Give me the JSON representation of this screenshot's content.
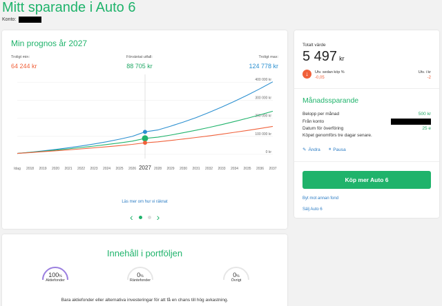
{
  "page": {
    "title": "Mitt sparande i Auto 6",
    "konto_label": "Konto:"
  },
  "prognos": {
    "title": "Min prognos år 2027",
    "min_label": "Troligt min:",
    "min_value": "64 244 kr",
    "expected_label": "Förväntat utfall:",
    "expected_value": "88 705 kr",
    "max_label": "Troligt max:",
    "max_value": "124 778 kr",
    "read_more": "Läs mer om hur vi räknat"
  },
  "chart_data": {
    "type": "line",
    "x": [
      "Idag",
      "2018",
      "2019",
      "2020",
      "2021",
      "2022",
      "2023",
      "2024",
      "2025",
      "2026",
      "2027",
      "2028",
      "2029",
      "2030",
      "2031",
      "2032",
      "2033",
      "2034",
      "2035",
      "2036",
      "2037"
    ],
    "highlight_x": "2027",
    "y_tick_labels": [
      "400 000 kr",
      "300 000 kr",
      "200 000 kr",
      "100 000 kr",
      "0 kr"
    ],
    "y_ticks": [
      400000,
      300000,
      200000,
      100000,
      0
    ],
    "ylim": [
      0,
      420000
    ],
    "series": [
      {
        "name": "Troligt max",
        "color": "#2a8fd0",
        "values": [
          5497,
          12000,
          19500,
          27500,
          36500,
          46500,
          57500,
          70000,
          84000,
          99500,
          124778,
          135000,
          156000,
          179000,
          204000,
          232000,
          262000,
          294000,
          328000,
          364000,
          402000
        ]
      },
      {
        "name": "Förväntat utfall",
        "color": "#1fb36b",
        "values": [
          5497,
          11000,
          17000,
          23500,
          30500,
          38000,
          46000,
          54500,
          63500,
          73500,
          88705,
          95000,
          107000,
          120000,
          134000,
          149000,
          165000,
          182000,
          200000,
          219000,
          239000
        ]
      },
      {
        "name": "Troligt min",
        "color": "#f0603a",
        "values": [
          5497,
          10000,
          14800,
          19800,
          25000,
          30500,
          36300,
          42300,
          48600,
          55200,
          64244,
          69500,
          77000,
          85000,
          93500,
          102500,
          112000,
          122000,
          132500,
          143500,
          155000
        ]
      }
    ]
  },
  "summary": {
    "total_label": "Totalt värde",
    "total_value": "5 497",
    "total_unit": "kr",
    "dev_pct_label": "Utv. sedan köp %",
    "dev_pct_value": "-0,05",
    "dev_kr_label": "Utv. i kr",
    "dev_kr_value": "-2"
  },
  "monthly": {
    "title": "Månadssparande",
    "amount_label": "Belopp per månad",
    "amount_value": "500 kr",
    "from_label": "Från konto",
    "date_label": "Datum för överföring",
    "date_value": "25 e",
    "note": "Köpet genomförs tre dagar senare.",
    "edit_label": "Ändra",
    "pause_label": "Pausa"
  },
  "actions": {
    "buy_label": "Köp mer Auto 6",
    "switch_label": "Byt mot annan fond",
    "sell_label": "Sälj Auto 6"
  },
  "content": {
    "title": "Innehåll i portföljen",
    "items": [
      {
        "pct": "100",
        "label": "Aktiefonder",
        "fraction": 1.0
      },
      {
        "pct": "0",
        "label": "Räntefonder",
        "fraction": 0
      },
      {
        "pct": "0",
        "label": "Övrigt",
        "fraction": 0
      }
    ],
    "note": "Bara aktiefonder eller alternativa investeringar för att få en chans till hög avkastning."
  },
  "colors": {
    "accent": "#1fb36b",
    "min": "#f0603a",
    "max": "#2a8fd0",
    "link": "#2b7cc4"
  }
}
